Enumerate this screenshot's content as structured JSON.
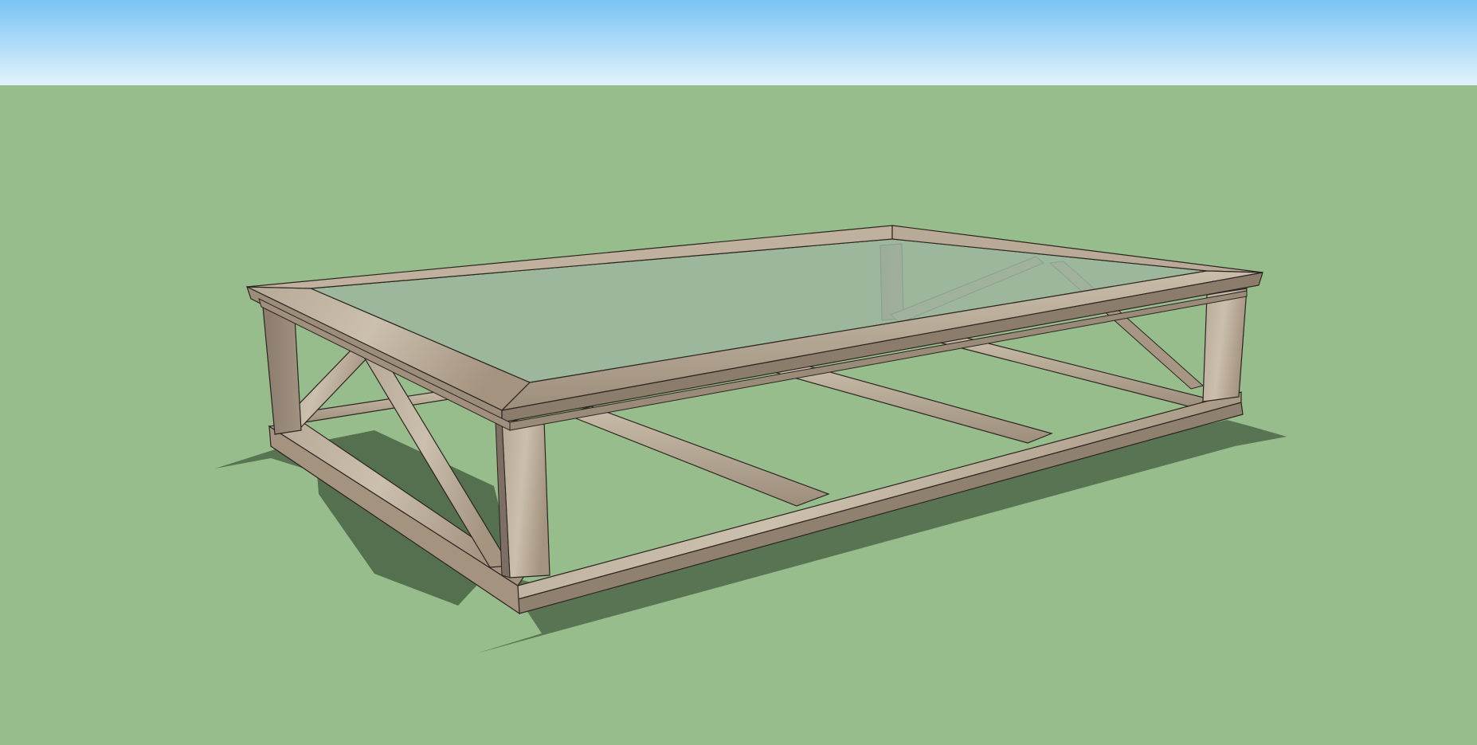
{
  "viewport": {
    "sky_top_color": "#79c3f3",
    "sky_bottom_color": "#e2f3fc",
    "ground_color": "#98bd8c",
    "shadow_color": "#55704f"
  },
  "model": {
    "description_icon": "wooden-glass-top-coffee-table-model",
    "wood_light": "#c6b9a6",
    "wood_mid": "#a89987",
    "wood_dark": "#7d6f63",
    "edge_color": "#2b2421",
    "glass_color": "#9fb6a1"
  }
}
